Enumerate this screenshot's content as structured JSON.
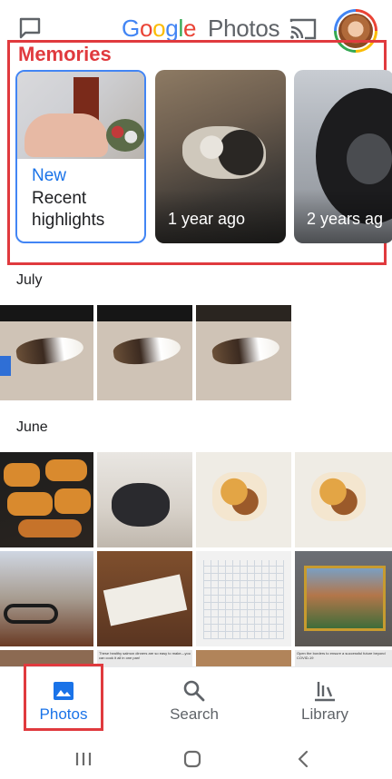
{
  "header": {
    "logo_google_letters": [
      "G",
      "o",
      "o",
      "g",
      "l",
      "e"
    ],
    "logo_google_colors": [
      "#4285f4",
      "#ea4335",
      "#fbbc05",
      "#4285f4",
      "#34a853",
      "#ea4335"
    ],
    "logo_product": "Photos",
    "icons": [
      "chat-icon",
      "cast-icon",
      "profile-avatar"
    ]
  },
  "memories": {
    "title": "Memories",
    "cards": [
      {
        "badge": "New",
        "label": "Recent highlights"
      },
      {
        "label": "1 year ago"
      },
      {
        "label": "2 years ag"
      }
    ]
  },
  "sections": [
    {
      "title": "July"
    },
    {
      "title": "June"
    }
  ],
  "grid_captions": {
    "salmon": "These healthy salmon dinners are so easy to make—you can cook it all in one pan!",
    "covid": "Open the borders to ensure a successful future beyond COVID-19"
  },
  "bottom_nav": {
    "items": [
      {
        "label": "Photos",
        "icon": "photos-icon",
        "active": true
      },
      {
        "label": "Search",
        "icon": "search-icon",
        "active": false
      },
      {
        "label": "Library",
        "icon": "library-icon",
        "active": false
      }
    ]
  },
  "system_nav": {
    "icons": [
      "recent-apps-icon",
      "home-icon",
      "back-icon"
    ]
  },
  "colors": {
    "accent": "#1a73e8",
    "annotation_red": "#e03a3e"
  }
}
